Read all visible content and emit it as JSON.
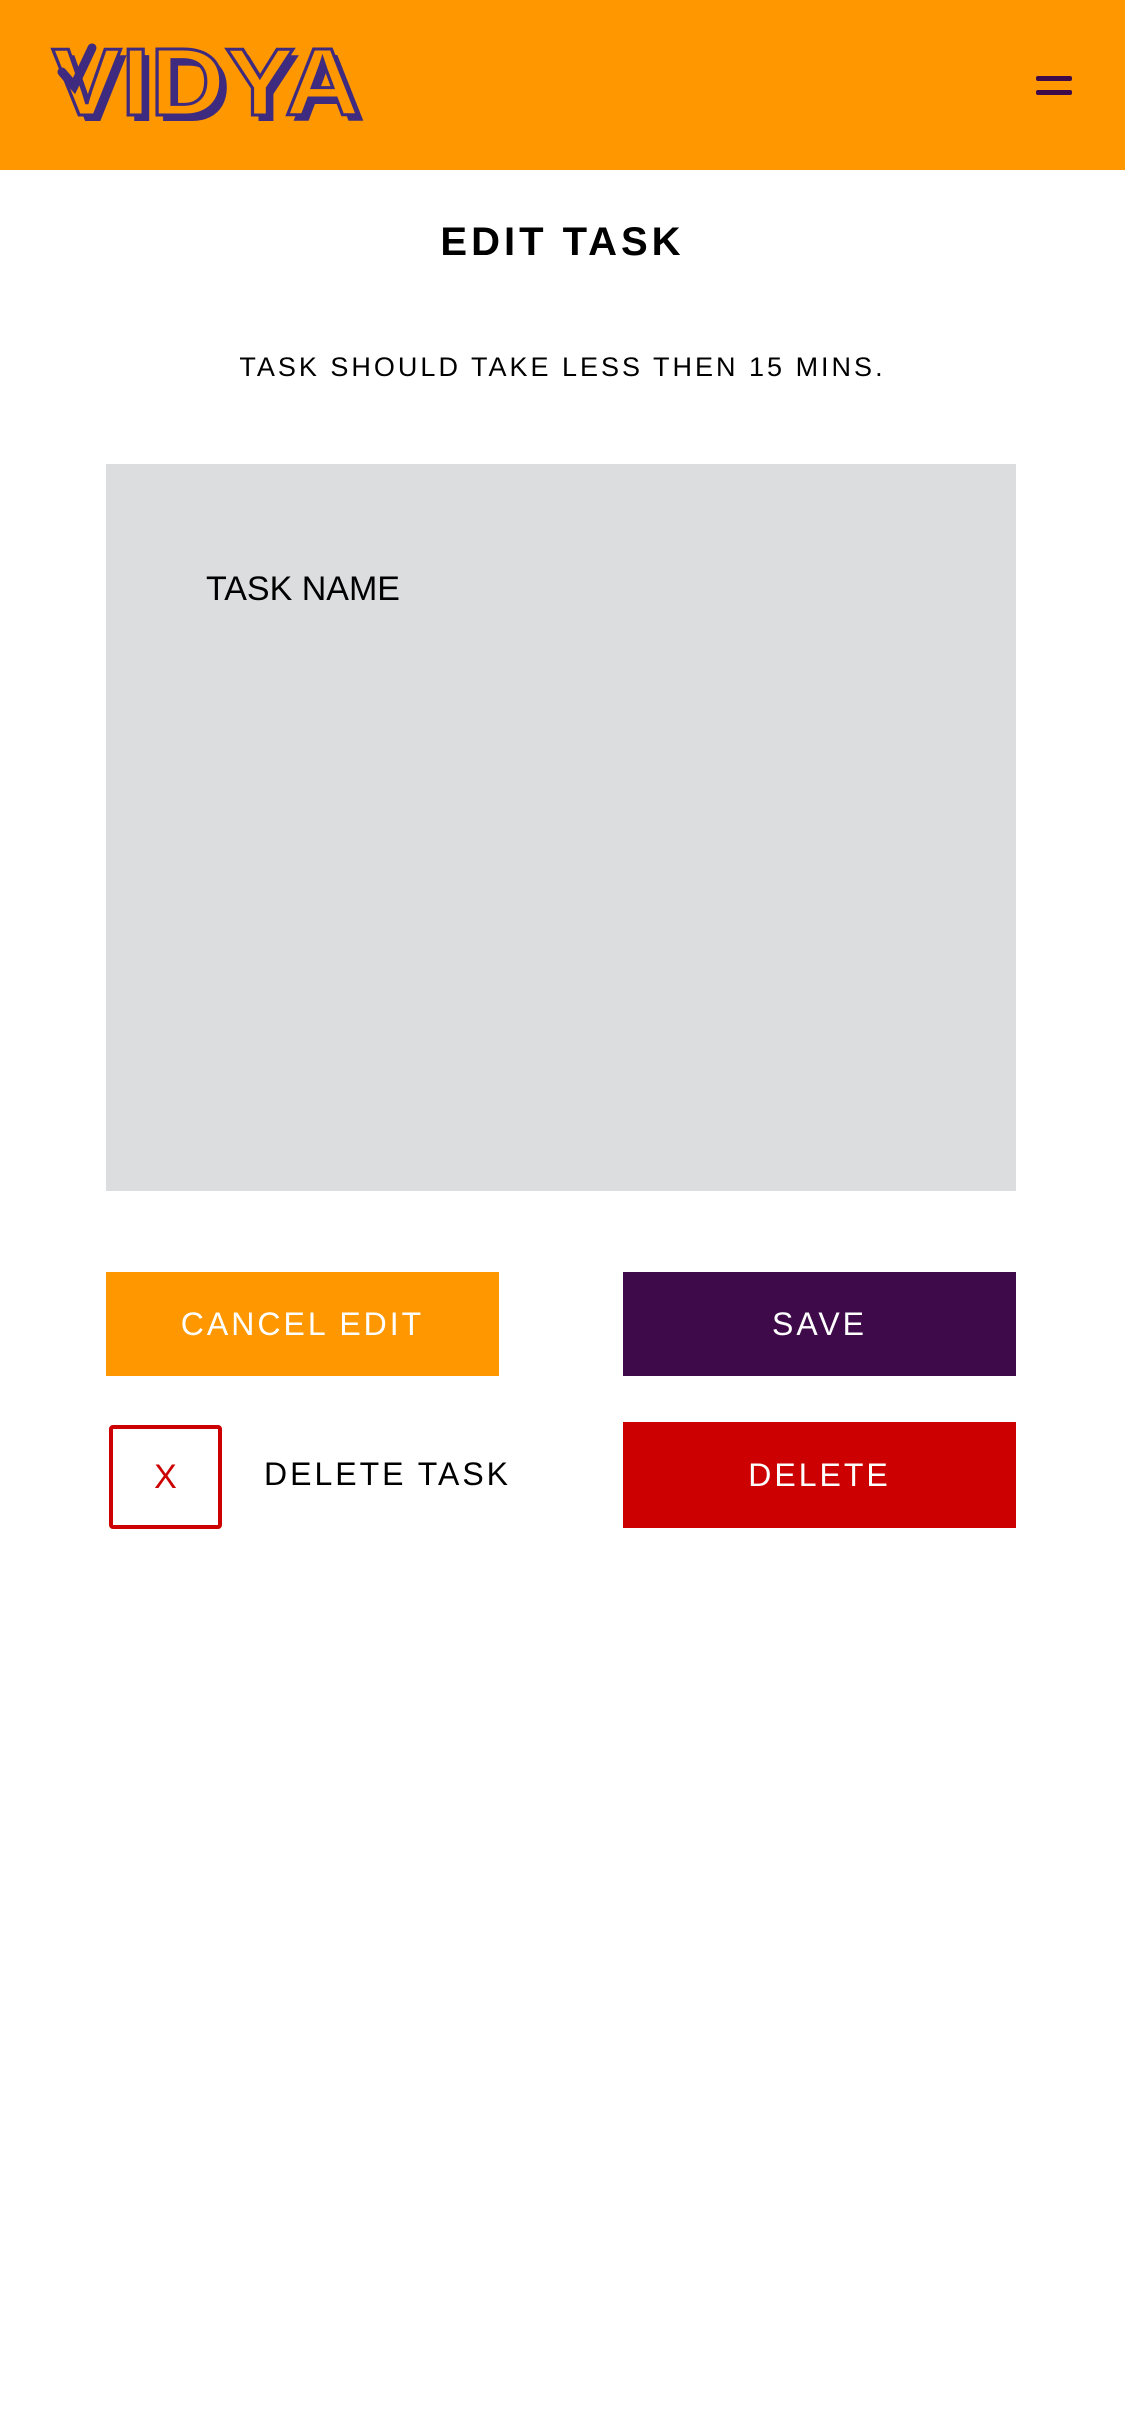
{
  "header": {
    "logo_text": "VIDYA",
    "brand_color": "#FF9800",
    "logo_color": "#3E2A7E",
    "menu_icon": "hamburger-menu-icon"
  },
  "page": {
    "title": "EDIT TASK",
    "hint": "TASK SHOULD TAKE LESS THEN 15 MINS."
  },
  "task": {
    "name_placeholder": "TASK NAME",
    "name_value": ""
  },
  "actions": {
    "cancel_label": "CANCEL EDIT",
    "save_label": "SAVE",
    "delete_toggle_label": "X",
    "delete_task_label": "DELETE TASK",
    "delete_label": "DELETE"
  },
  "colors": {
    "orange": "#FF9800",
    "purple": "#3E0A4A",
    "red": "#CC0000",
    "input_background": "#DCDDDF"
  }
}
